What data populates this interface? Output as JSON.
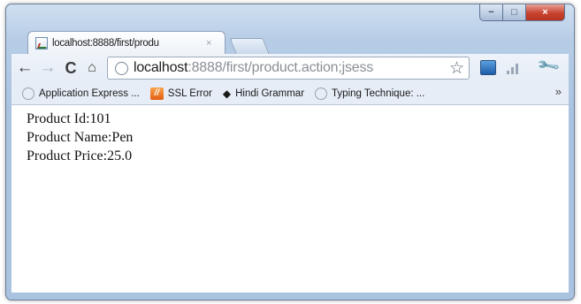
{
  "window": {
    "controls": {
      "minimize": "−",
      "maximize": "□",
      "close": "×"
    }
  },
  "tab": {
    "title": "localhost:8888/first/produ",
    "close": "×",
    "favicon": "page-icon"
  },
  "toolbar": {
    "back": "←",
    "forward": "→",
    "reload": "C",
    "home": "⌂",
    "url_host": "localhost",
    "url_rest": ":8888/first/product.action;jsess",
    "star": "☆",
    "wrench": "🔧"
  },
  "bookmarks": {
    "items": [
      {
        "label": "Application Express ...",
        "icon": "globe-icon"
      },
      {
        "label": "SSL Error",
        "icon": "ssl-error-icon"
      },
      {
        "label": "Hindi Grammar",
        "icon": "diamond-icon"
      },
      {
        "label": "Typing Technique: ...",
        "icon": "globe-icon"
      }
    ],
    "overflow": "»"
  },
  "page": {
    "lines": [
      "Product Id:101",
      "Product Name:Pen",
      "Product Price:25.0"
    ]
  }
}
